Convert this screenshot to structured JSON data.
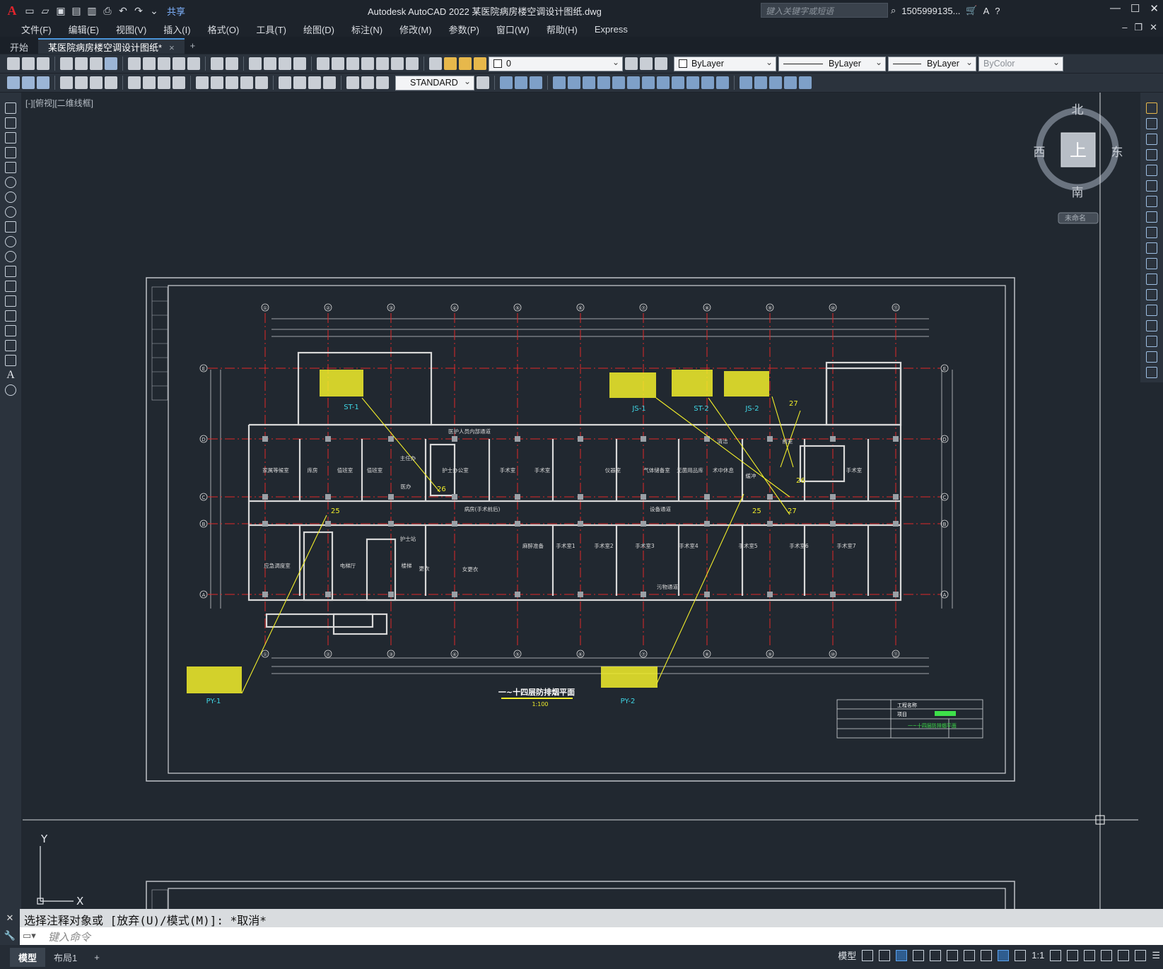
{
  "app": {
    "logo": "A",
    "title": "Autodesk AutoCAD 2022    某医院病房楼空调设计图纸.dwg",
    "share": "共享"
  },
  "search": {
    "placeholder": "键入关键字或短语"
  },
  "user": {
    "name": "1505999135...",
    "help": "?"
  },
  "menu": [
    "文件(F)",
    "编辑(E)",
    "视图(V)",
    "插入(I)",
    "格式(O)",
    "工具(T)",
    "绘图(D)",
    "标注(N)",
    "修改(M)",
    "参数(P)",
    "窗口(W)",
    "帮助(H)",
    "Express"
  ],
  "tabs": {
    "start": "开始",
    "doc": "某医院病房楼空调设计图纸*",
    "close": "×",
    "add": "+"
  },
  "toolbar": {
    "layer": "0",
    "textstyle": "STANDARD",
    "color": "ByLayer",
    "linetype": "ByLayer",
    "lineweight": "ByLayer",
    "plotstyle": "ByColor"
  },
  "viewport": {
    "label": "[-][俯视][二维线框]"
  },
  "viewcube": {
    "north": "北",
    "south": "南",
    "east": "东",
    "west": "西",
    "top": "上",
    "wcs": "未命名"
  },
  "ucs": {
    "x": "X",
    "y": "Y"
  },
  "drawing": {
    "title": "一~十四层防排烟平面",
    "scale": "1:100",
    "grid_cols": [
      "①",
      "②",
      "③",
      "④",
      "⑤",
      "⑥",
      "⑦",
      "⑧",
      "⑨",
      "⑩",
      "⑪"
    ],
    "grid_rows": [
      "E",
      "D",
      "C",
      "B",
      "A"
    ],
    "tags": [
      "ST-1",
      "JS-1",
      "ST-2",
      "JS-2",
      "PY-1",
      "PY-2"
    ],
    "numbers": [
      "26",
      "25",
      "27",
      "26",
      "25",
      "27"
    ],
    "rooms": [
      "家属等候室",
      "库房",
      "值班室",
      "值班室",
      "主任办",
      "医办",
      "护士办公室",
      "手术室",
      "手术室",
      "仪器室",
      "气体储备室",
      "无菌用品库",
      "术中休息",
      "缓冲",
      "护士站",
      "病房(手术前后)",
      "设备通道",
      "应急调度室",
      "电梯厅",
      "楼梯",
      "更衣",
      "女更衣",
      "麻醉准备",
      "手术室1",
      "手术室2",
      "手术室3",
      "手术室4",
      "手术室5",
      "手术室6",
      "手术室7",
      "污物通道",
      "清洁",
      "前室",
      "手术室",
      "医护人员内部通道"
    ],
    "titleblock": {
      "project": "工程名称",
      "item": "项目",
      "name": "一~十四层防排烟平面"
    }
  },
  "command": {
    "history": "选择注释对象或 [放弃(U)/模式(M)]: *取消*",
    "placeholder": "键入命令"
  },
  "status": {
    "model": "模型",
    "layout1": "布局1",
    "add": "+",
    "model_btn": "模型",
    "scale": "1:1"
  },
  "colors": {
    "bg": "#212830",
    "red": "#e02828",
    "yellow": "#f2ee2a",
    "cyan": "#3fd7e6",
    "wall": "#d8d8d8",
    "green": "#3ee04a"
  }
}
